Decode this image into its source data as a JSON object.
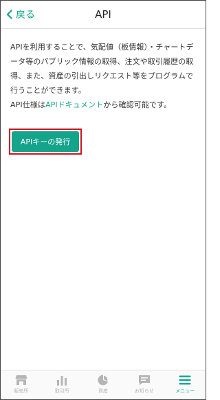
{
  "header": {
    "back_label": "戻る",
    "title": "API"
  },
  "content": {
    "paragraph1": "APIを利用することで、気配値（板情報）・チャートデータ等のパブリック情報の取得、注文や取引履歴の取得、また、資産の引出しリクエスト等をプログラムで行うことができます。",
    "spec_prefix": "API仕様は",
    "spec_link": "APIドキュメント",
    "spec_suffix": "から確認可能です。",
    "issue_button": "APIキーの発行"
  },
  "tabbar": {
    "items": [
      {
        "label": "販売所",
        "icon": "store-icon"
      },
      {
        "label": "取引所",
        "icon": "bar-chart-icon"
      },
      {
        "label": "資産",
        "icon": "pie-chart-icon"
      },
      {
        "label": "お知らせ",
        "icon": "message-icon"
      },
      {
        "label": "メニュー",
        "icon": "menu-icon"
      }
    ],
    "active_index": 4
  },
  "colors": {
    "accent": "#14a38b",
    "highlight_border": "#d1101f",
    "inactive_tab": "#b5b5b5"
  }
}
